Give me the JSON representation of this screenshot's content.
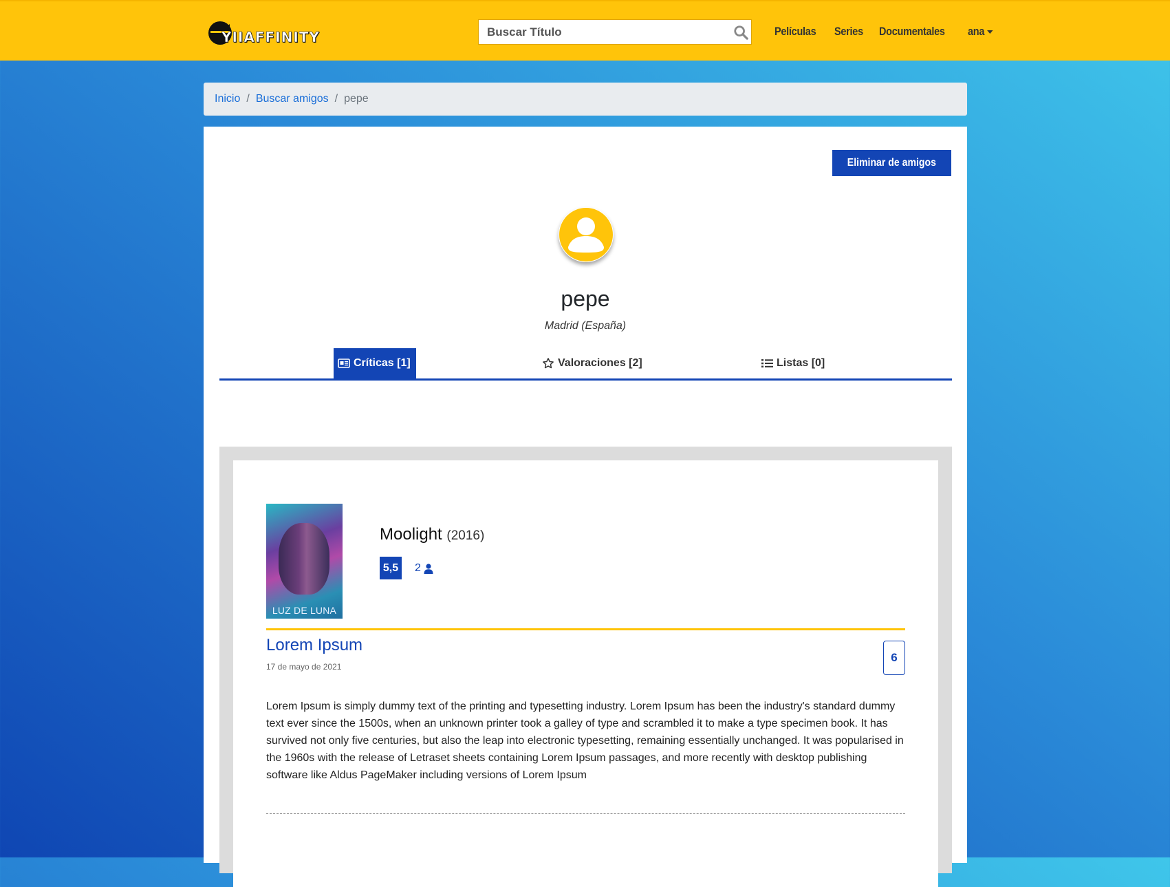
{
  "navbar": {
    "logo_text": "YIIAFFINITY",
    "search_placeholder": "Buscar Título",
    "links": [
      "Películas",
      "Series",
      "Documentales"
    ],
    "user": "ana"
  },
  "breadcrumb": {
    "items": [
      "Inicio",
      "Buscar amigos"
    ],
    "active": "pepe"
  },
  "profile": {
    "remove_button": "Eliminar de amigos",
    "username": "pepe",
    "location": "Madrid (España)",
    "tabs": [
      {
        "label": "Críticas [1]",
        "icon": "newspaper-icon",
        "active": true
      },
      {
        "label": "Valoraciones [2]",
        "icon": "star-icon",
        "active": false
      },
      {
        "label": "Listas [0]",
        "icon": "list-icon",
        "active": false
      }
    ]
  },
  "review": {
    "poster_title": "LUZ DE LUNA",
    "movie_title": "Moolight",
    "movie_year": "(2016)",
    "average_score": "5,5",
    "voters": "2",
    "title": "Lorem Ipsum",
    "date": "17 de mayo de 2021",
    "score": "6",
    "body": "Lorem Ipsum is simply dummy text of the printing and typesetting industry. Lorem Ipsum has been the industry's standard dummy text ever since the 1500s, when an unknown printer took a galley of type and scrambled it to make a type specimen book. It has survived not only five centuries, but also the leap into electronic typesetting, remaining essentially unchanged. It was popularised in the 1960s with the release of Letraset sheets containing Lorem Ipsum passages, and more recently with desktop publishing software like Aldus PageMaker including versions of Lorem Ipsum"
  },
  "colors": {
    "brand_yellow": "#ffc40a",
    "brand_blue": "#1345b5",
    "link_blue": "#1a6ed8"
  }
}
